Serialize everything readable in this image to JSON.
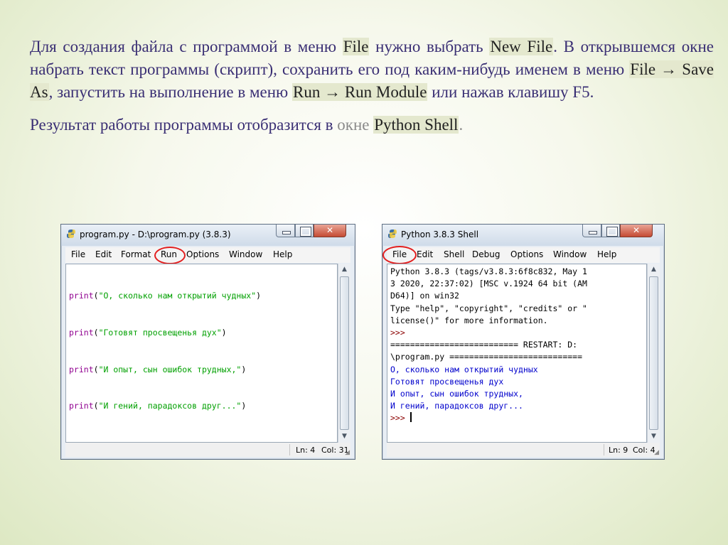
{
  "slide": {
    "p1": {
      "t1": "Для создания файла с программой в меню ",
      "h1": "File",
      "t2": " нужно выбрать ",
      "h2": "New File",
      "t3": ". В открывшемся окне набрать текст программы (скрипт), сохранить его под каким-нибудь именем в меню ",
      "h3": "File → Save As",
      "t4": ", запустить на выполнение в меню ",
      "h4": "Run → Run Module",
      "t5": " или нажав клавишу F5."
    },
    "p2": {
      "t1": "Результат работы программы отобразится в ",
      "g1": "окне",
      "t2": " ",
      "h1": "Python Shell",
      "g2": "."
    }
  },
  "editor_window": {
    "title": "program.py - D:\\program.py (3.8.3)",
    "menu": [
      "File",
      "Edit",
      "Format",
      "Run",
      "Options",
      "Window",
      "Help"
    ],
    "code_lines": [
      {
        "kw": "print",
        "open": "(",
        "str": "\"О, сколько нам открытий чудных\"",
        "close": ")"
      },
      {
        "kw": "print",
        "open": "(",
        "str": "\"Готовят просвещенья дух\"",
        "close": ")"
      },
      {
        "kw": "print",
        "open": "(",
        "str": "\"И опыт, сын ошибок трудных,\"",
        "close": ")"
      },
      {
        "kw": "print",
        "open": "(",
        "str": "\"И гений, парадоксов друг...\"",
        "close": ")"
      }
    ],
    "status": {
      "ln": "Ln: 4",
      "col": "Col: 31"
    }
  },
  "shell_window": {
    "title": "Python 3.8.3 Shell",
    "menu": [
      "File",
      "Edit",
      "Shell",
      "Debug",
      "Options",
      "Window",
      "Help"
    ],
    "lines": [
      {
        "text": "Python 3.8.3 (tags/v3.8.3:6f8c832, May 1",
        "type": "plain"
      },
      {
        "text": "3 2020, 22:37:02) [MSC v.1924 64 bit (AM",
        "type": "plain"
      },
      {
        "text": "D64)] on win32",
        "type": "plain"
      },
      {
        "text": "Type \"help\", \"copyright\", \"credits\" or \"",
        "type": "plain"
      },
      {
        "text": "license()\" for more information.",
        "type": "plain"
      },
      {
        "text": ">>>",
        "type": "prompt"
      },
      {
        "text": "========================== RESTART: D:",
        "type": "plain"
      },
      {
        "text": "\\program.py ===========================",
        "type": "plain"
      },
      {
        "text": "О, сколько нам открытий чудных",
        "type": "out"
      },
      {
        "text": "Готовят просвещенья дух",
        "type": "out"
      },
      {
        "text": "И опыт, сын ошибок трудных,",
        "type": "out"
      },
      {
        "text": "И гений, парадоксов друг...",
        "type": "out"
      }
    ],
    "prompt": ">>> ",
    "status": {
      "ln": "Ln: 9",
      "col": "Col: 4"
    }
  },
  "colors": {
    "slide_text": "#3a2f74",
    "highlight": "#e4e8ce",
    "keyword": "#900090",
    "string": "#00a000",
    "output": "#0000cc",
    "circle": "#e21e1e"
  },
  "icons": {
    "app": "python-idle-icon",
    "minimize": "minimize-icon",
    "maximize": "maximize-icon",
    "close": "close-icon"
  }
}
